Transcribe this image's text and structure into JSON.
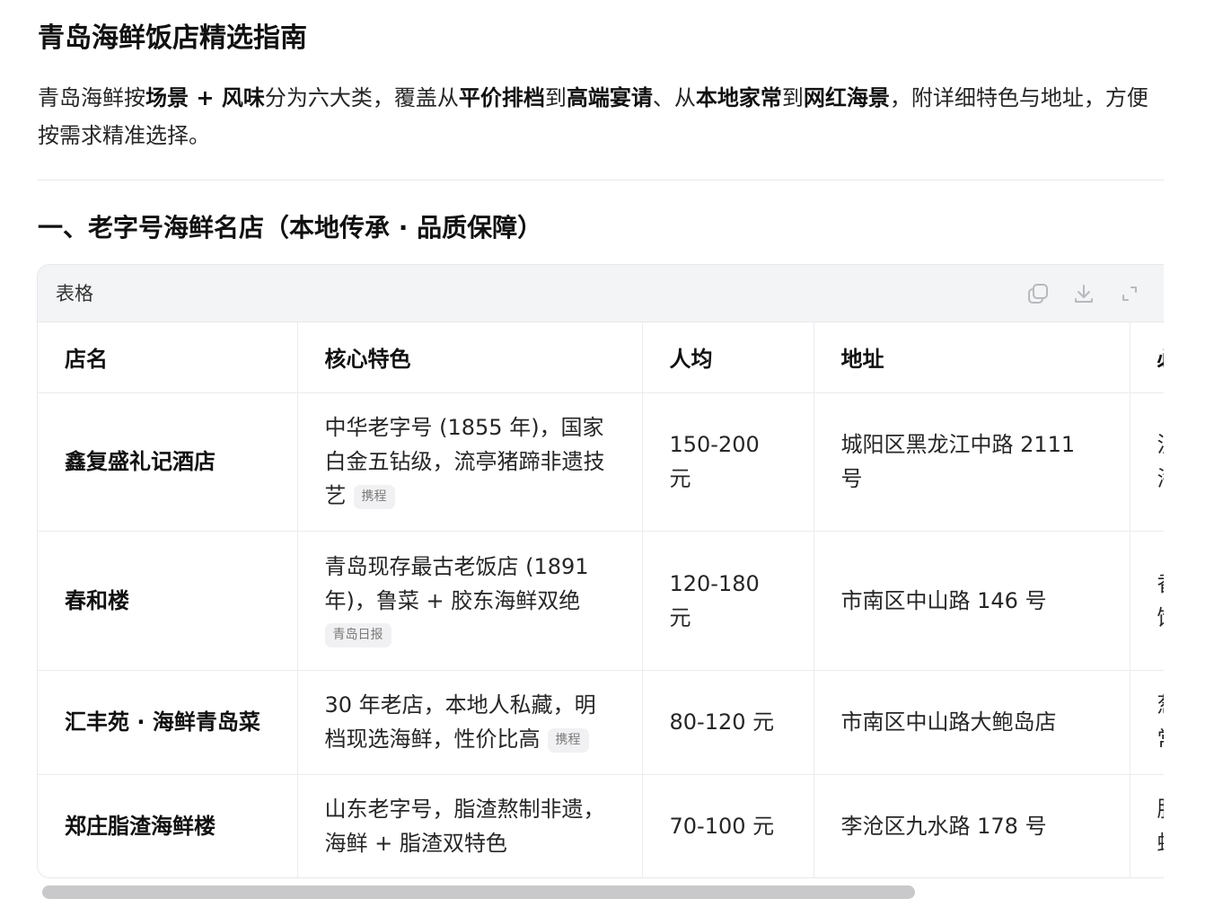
{
  "page": {
    "title": "青岛海鲜饭店精选指南",
    "intro": {
      "p1": "青岛海鲜按",
      "b1": "场景 + 风味",
      "p2": "分为六大类，覆盖从",
      "b2": "平价排档",
      "p3": "到",
      "b3": "高端宴请",
      "p4": "、从",
      "b4": "本地家常",
      "p5": "到",
      "b5": "网红海景",
      "p6": "，附详细特色与地址，方便按需求精准选择。"
    },
    "section_title": "一、老字号海鲜名店（本地传承 · 品质保障）"
  },
  "table_card": {
    "label": "表格",
    "icons": [
      "copy-icon",
      "download-icon",
      "expand-icon"
    ],
    "columns": [
      "店名",
      "核心特色",
      "人均",
      "地址",
      "必"
    ],
    "rows": [
      {
        "name": "鑫复盛礼记酒店",
        "feature": "中华老字号 (1855 年)，国家白金五钻级，流亭猪蹄非遗技艺",
        "source": "携程",
        "price": "150-200 元",
        "address": "城阳区黑龙江中路 2111 号",
        "extra": "流\n海"
      },
      {
        "name": "春和楼",
        "feature": "青岛现存最古老饭店 (1891 年)，鲁菜 + 胶东海鲜双绝",
        "source": "青岛日报",
        "price": "120-180 元",
        "address": "市南区中山路 146 号",
        "extra": "香\n饭"
      },
      {
        "name": "汇丰苑 · 海鲜青岛菜",
        "feature": "30 年老店，本地人私藏，明档现选海鲜，性价比高",
        "source": "携程",
        "price": "80-120 元",
        "address": "市南区中山路大鲍岛店",
        "extra": "葱\n常"
      },
      {
        "name": "郑庄脂渣海鲜楼",
        "feature": "山东老字号，脂渣熬制非遗，海鲜 + 脂渣双特色",
        "source": "",
        "price": "70-100 元",
        "address": "李沧区九水路 178 号",
        "extra": "脂\n蛤"
      }
    ]
  },
  "colors": {
    "header_bg": "#f3f4f6",
    "border": "#e7e7ea",
    "tag_bg": "#f1f1f3",
    "scrollbar": "#c9c9cc"
  }
}
